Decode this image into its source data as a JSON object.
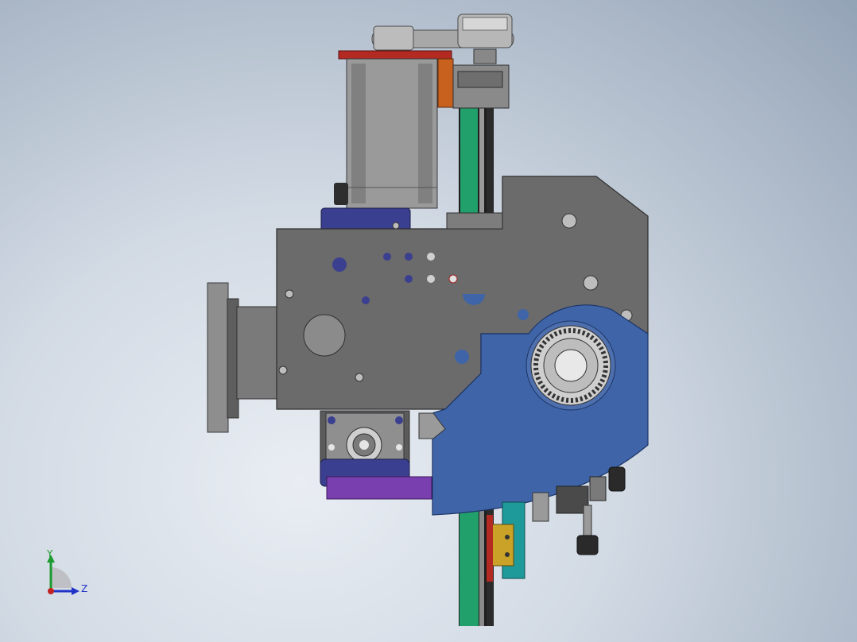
{
  "viewport": {
    "triad": {
      "y_label": "Y",
      "z_label": "Z"
    }
  },
  "colors": {
    "background_top": "#93a3b6",
    "background_bottom": "#e9edf3",
    "housing_gray": "#6b6b6b",
    "blue_bracket": "#3f65a8",
    "green_rail": "#22a06b",
    "red_plate": "#b22a22",
    "orange_block": "#c8611e",
    "purple_plate": "#7a3fae",
    "navy_block": "#3b3f8f",
    "teal_carriage": "#1e9a9a",
    "yellow_block": "#c9a227",
    "motor_gray": "#8d8d8d"
  },
  "icons": [
    "coordinate-triad-icon"
  ]
}
